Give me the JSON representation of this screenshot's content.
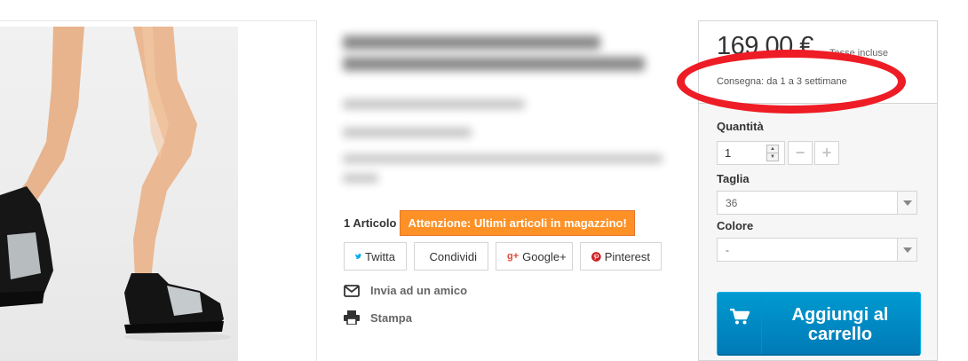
{
  "product": {
    "stock_quantity": "1 Articolo",
    "stock_warning": "Attenzione: Ultimi articoli in magazzino!"
  },
  "social": {
    "twitter": "Twitta",
    "facebook": "Condividi",
    "google": "Google+",
    "pinterest": "Pinterest"
  },
  "actions": {
    "send_friend": "Invia ad un amico",
    "print": "Stampa"
  },
  "buy_box": {
    "price": "169,00 €",
    "tax_note": "Tasse incluse",
    "delivery": "Consegna: da 1 a 3 settimane",
    "quantity_label": "Quantità",
    "quantity_value": "1",
    "size_label": "Taglia",
    "size_value": "36",
    "color_label": "Colore",
    "color_value": "-",
    "add_to_cart": "Aggiungi al carrello"
  },
  "colors": {
    "warning": "#fe9126",
    "cart_button": "#0090c9",
    "annotation_ring": "#ee1c25"
  },
  "icons": {
    "twitter": "twitter-icon",
    "facebook": "facebook-icon",
    "google": "google-plus-icon",
    "pinterest": "pinterest-icon",
    "send_friend": "envelope-icon",
    "print": "printer-icon",
    "cart": "shopping-cart-icon"
  }
}
